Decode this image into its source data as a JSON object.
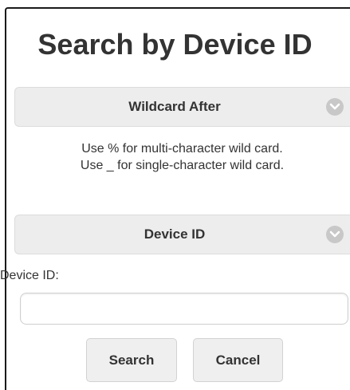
{
  "page": {
    "title": "Search by Device ID"
  },
  "wildcard_section": {
    "label": "Wildcard After",
    "icon": "chevron-down-icon",
    "hints": [
      "Use % for multi-character wild card.",
      "Use _ for single-character wild card."
    ]
  },
  "device_section": {
    "label": "Device ID",
    "icon": "chevron-down-icon"
  },
  "device_field": {
    "label": "Device ID:",
    "value": "",
    "placeholder": ""
  },
  "actions": {
    "search_label": "Search",
    "cancel_label": "Cancel"
  },
  "colors": {
    "panel_bg": "#ededed",
    "chevron_bg": "#c8c8c8",
    "text": "#333333",
    "button_bg": "#efefef"
  }
}
